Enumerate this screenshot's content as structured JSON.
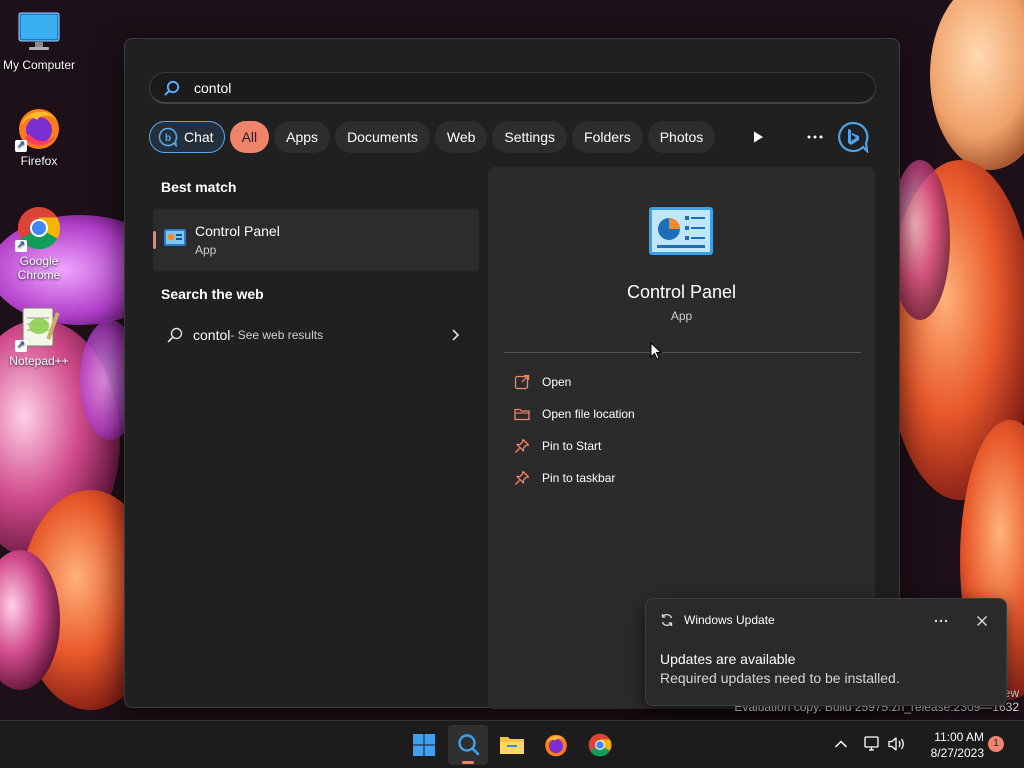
{
  "desktop": {
    "icons": [
      {
        "label": "My Computer",
        "icon": "monitor-icon"
      },
      {
        "label": "Firefox",
        "icon": "firefox-icon"
      },
      {
        "label": "Google Chrome",
        "icon": "chrome-icon"
      },
      {
        "label": "Notepad++",
        "icon": "notepadpp-icon"
      }
    ]
  },
  "search": {
    "query": "contol",
    "filters": {
      "chat": "Chat",
      "all": "All",
      "apps": "Apps",
      "documents": "Documents",
      "web": "Web",
      "settings": "Settings",
      "folders": "Folders",
      "photos": "Photos"
    },
    "best_match_label": "Best match",
    "best_match": {
      "title": "Control Panel",
      "subtitle": "App"
    },
    "web_label": "Search the web",
    "web_result": {
      "query": "contol",
      "suffix": " - See web results"
    }
  },
  "preview": {
    "title": "Control Panel",
    "subtitle": "App",
    "actions": {
      "open": "Open",
      "open_location": "Open file location",
      "pin_start": "Pin to Start",
      "pin_taskbar": "Pin to taskbar"
    }
  },
  "notification": {
    "app": "Windows Update",
    "title": "Updates are available",
    "body": "Required updates need to be installed."
  },
  "watermark": {
    "line1": "ew",
    "line2": "Evaluation copy. Build 25975.zn_release.2309—1632"
  },
  "taskbar": {
    "time": "11:00 AM",
    "date": "8/27/2023",
    "notification_count": "1"
  },
  "colors": {
    "accent": "#f0846a",
    "chat_border": "#5aa7e8",
    "panel": "#202020"
  }
}
